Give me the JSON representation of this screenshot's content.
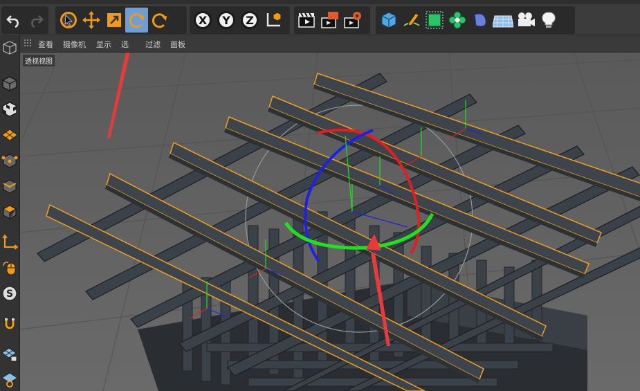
{
  "viewport_menu": {
    "view": "查看",
    "camera": "摄像机",
    "display": "显示",
    "select": "选",
    "filter": "过滤",
    "panel": "面板"
  },
  "viewport": {
    "label": "透视视图"
  },
  "toolbar": {
    "axis_x": "X",
    "axis_y": "Y",
    "axis_z": "Z"
  },
  "colors": {
    "accent": "#6e9ed2",
    "selection_outline": "#f0a020",
    "axis_x": "#e02020",
    "axis_y": "#20e020",
    "axis_z": "#2020e0",
    "annotation_arrow": "#e83a3a"
  }
}
